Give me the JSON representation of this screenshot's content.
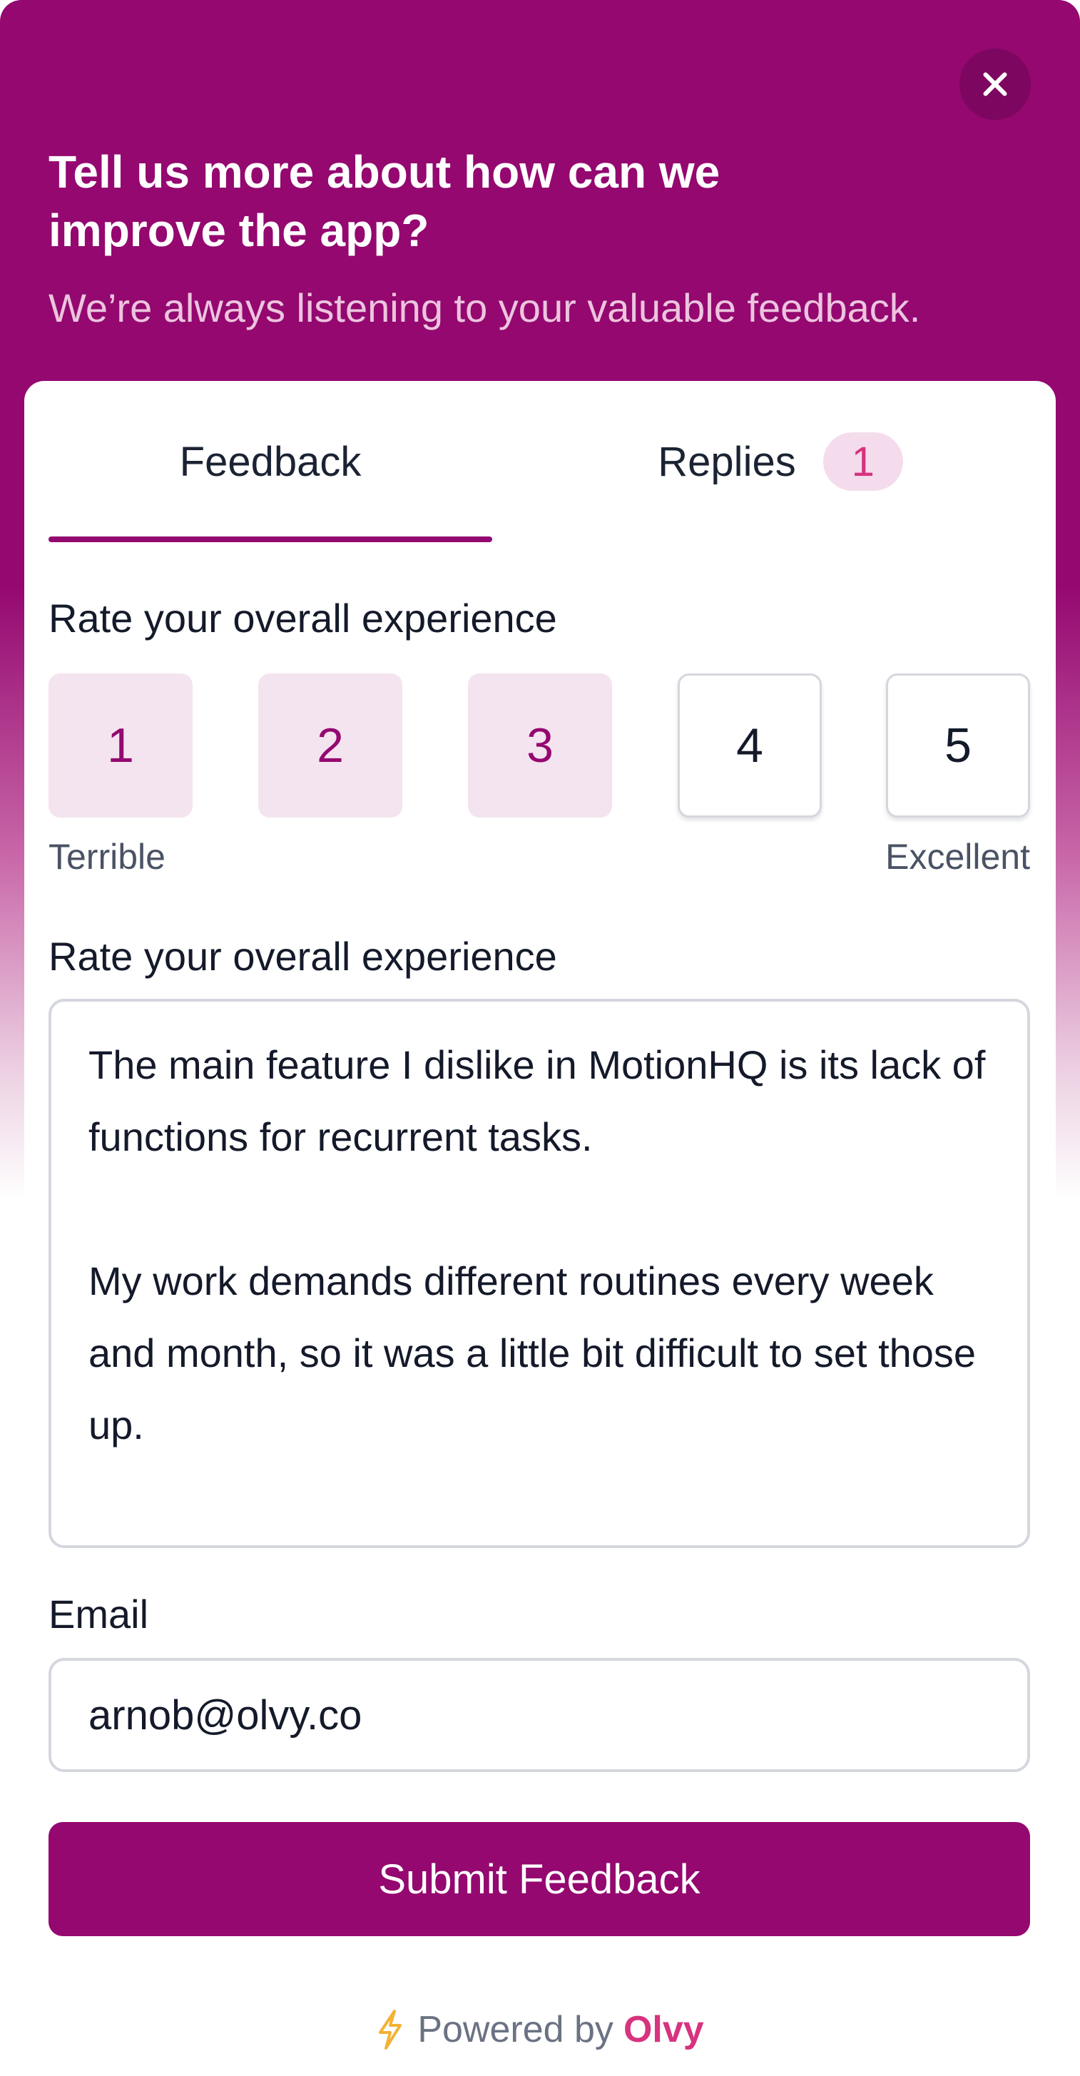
{
  "header": {
    "title": "Tell us more about how can we improve the app?",
    "subtitle": "We’re always listening to your valuable feedback."
  },
  "tabs": {
    "feedback_label": "Feedback",
    "replies_label": "Replies",
    "replies_count": "1",
    "active": "Feedback"
  },
  "rating": {
    "label": "Rate your overall experience",
    "options": [
      "1",
      "2",
      "3",
      "4",
      "5"
    ],
    "selected_up_to": 3,
    "low_label": "Terrible",
    "high_label": "Excellent"
  },
  "feedback": {
    "label": "Rate your overall experience",
    "value": "The main feature I dislike in MotionHQ is its lack of functions for recurrent tasks.\n\nMy work demands different routines every week and month, so it was a little bit difficult to set those up."
  },
  "email": {
    "label": "Email",
    "value": "arnob@olvy.co"
  },
  "submit_label": "Submit Feedback",
  "footer": {
    "powered_by": "Powered by",
    "brand": "Olvy"
  },
  "colors": {
    "brand_primary": "#940870",
    "brand_accent": "#d7337f",
    "selected_bg": "#f4e4ef"
  },
  "icons": {
    "close": "close-icon",
    "footer": "lightning-bolt-icon"
  }
}
